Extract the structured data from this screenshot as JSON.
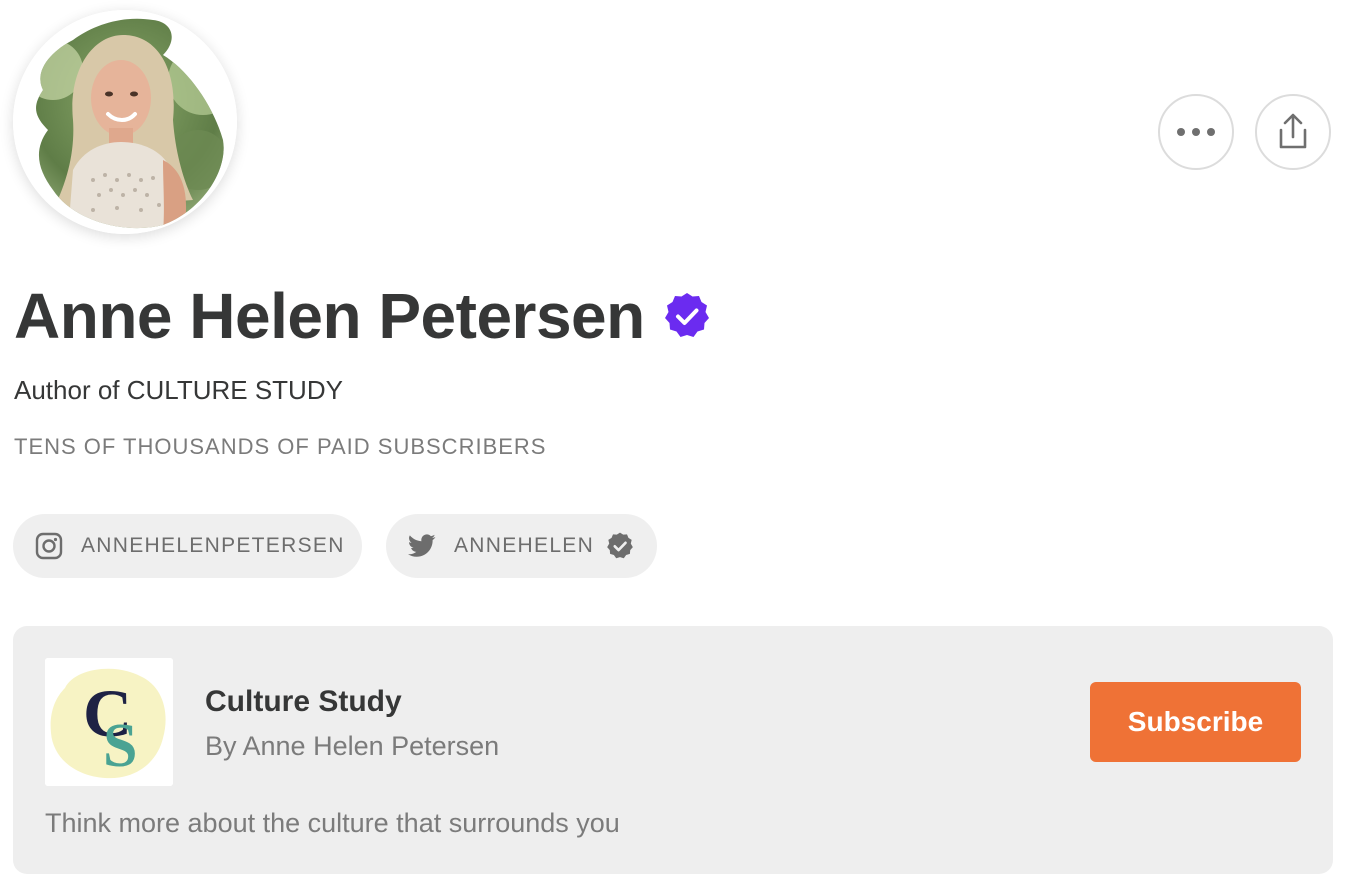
{
  "profile": {
    "name": "Anne Helen Petersen",
    "bio": "Author of CULTURE STUDY",
    "subscribers": "TENS OF THOUSANDS OF PAID SUBSCRIBERS",
    "verified_icon": "verified-badge-icon"
  },
  "actions": {
    "more_icon": "more-icon",
    "share_icon": "share-icon"
  },
  "social": {
    "instagram": {
      "icon": "instagram-icon",
      "handle": "ANNEHELENPETERSEN"
    },
    "twitter": {
      "icon": "twitter-icon",
      "handle": "ANNEHELEN",
      "verified_icon": "verified-icon"
    }
  },
  "publication": {
    "title": "Culture Study",
    "author": "By Anne Helen Petersen",
    "description": "Think more about the culture that surrounds you",
    "subscribe_label": "Subscribe",
    "logo_letters": "CS"
  },
  "colors": {
    "accent": "#ef7236",
    "verified": "#6b2bf0",
    "card_bg": "#eeeeee",
    "pill_bg": "#efefef"
  }
}
